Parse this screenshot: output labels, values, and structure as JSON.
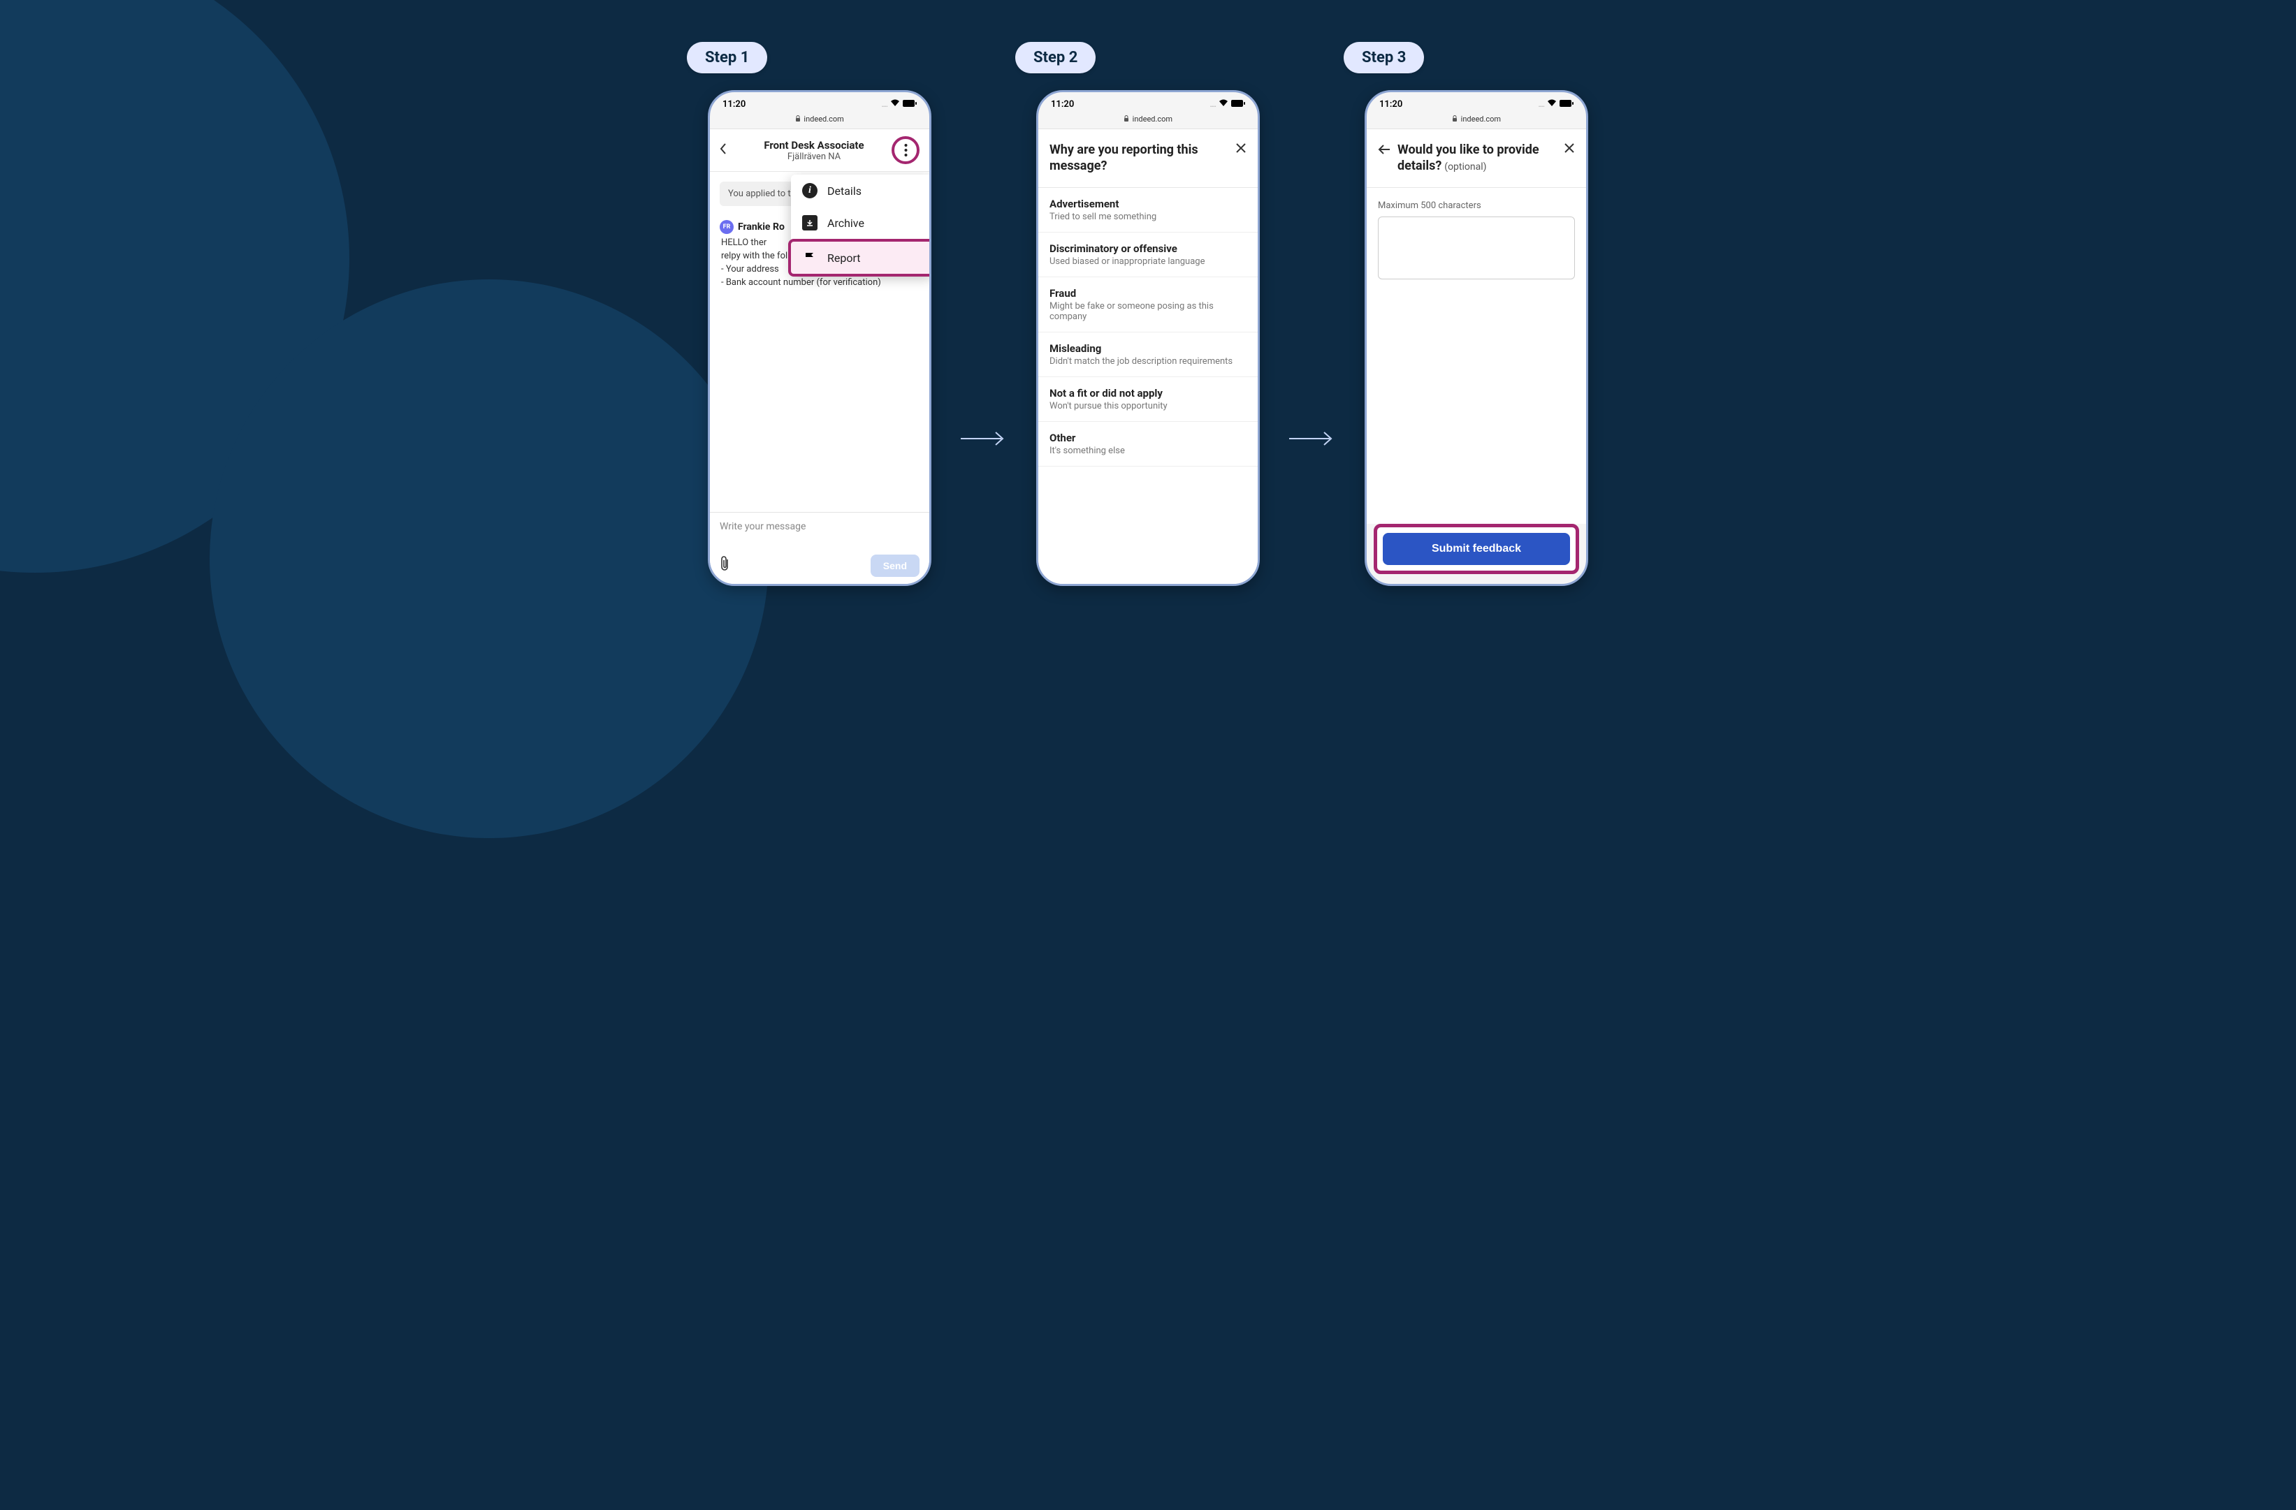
{
  "steps": {
    "s1": "Step 1",
    "s2": "Step 2",
    "s3": "Step 3"
  },
  "statusBar": {
    "time": "11:20"
  },
  "url": "indeed.com",
  "chat": {
    "jobTitle": "Front Desk Associate",
    "company": "Fjällräven NA",
    "appliedNotice": "You applied to t",
    "senderInitials": "FR",
    "senderName": "Frankie Ro",
    "messageLine1": "HELLO ther",
    "messageLine2": "relpy with the following INFORMATION ASAP to :",
    "messageLine3": "- Your address",
    "messageLine4": "- Bank account number (for verification)",
    "composePlaceholder": "Write your message",
    "sendLabel": "Send"
  },
  "menu": {
    "details": "Details",
    "archive": "Archive",
    "report": "Report"
  },
  "reportScreen": {
    "title": "Why are you reporting this message?",
    "reasons": [
      {
        "title": "Advertisement",
        "sub": "Tried to sell me something"
      },
      {
        "title": "Discriminatory or offensive",
        "sub": "Used biased or inappropriate language"
      },
      {
        "title": "Fraud",
        "sub": "Might be fake or someone posing as this company"
      },
      {
        "title": "Misleading",
        "sub": "Didn't match the job description requirements"
      },
      {
        "title": "Not a fit or did not apply",
        "sub": "Won't pursue this opportunity"
      },
      {
        "title": "Other",
        "sub": "It's something else"
      }
    ]
  },
  "detailsScreen": {
    "title": "Would you like to provide details?",
    "optional": "(optional)",
    "charHint": "Maximum 500 characters",
    "submitLabel": "Submit feedback"
  }
}
